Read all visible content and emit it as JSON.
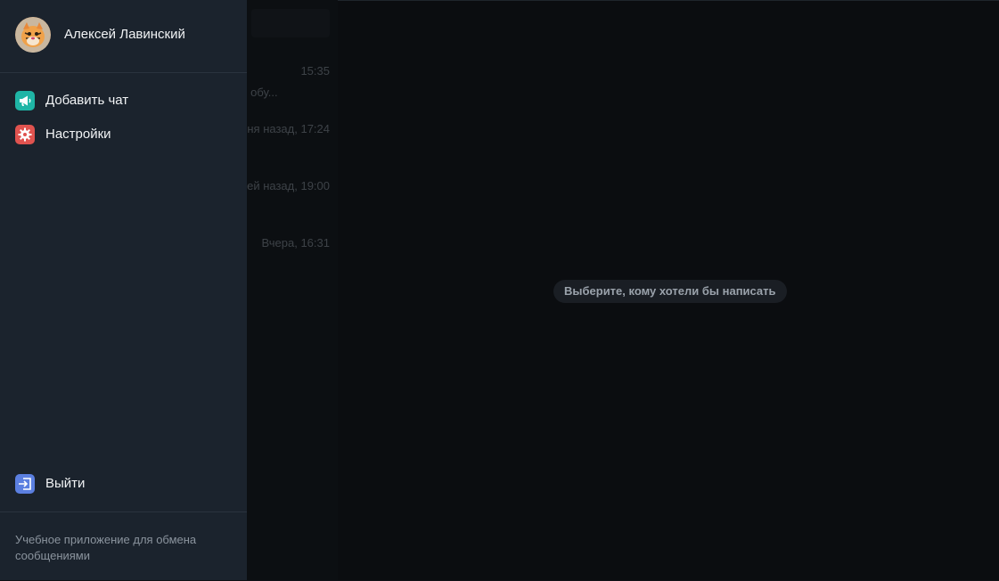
{
  "background_chats": {
    "rows": [
      {
        "time": "15:35",
        "preview": "сто обу..."
      },
      {
        "time": "ня назад, 17:24",
        "preview": ""
      },
      {
        "time": "ей назад, 19:00",
        "preview": ""
      },
      {
        "time": "Вчера, 16:31",
        "preview": ""
      }
    ]
  },
  "main": {
    "placeholder": "Выберите, кому хотели бы написать"
  },
  "drawer": {
    "user_name": "Алексей Лавинский",
    "menu": [
      {
        "label": "Добавить чат",
        "icon": "megaphone-icon",
        "color": "#1fb5a6"
      },
      {
        "label": "Настройки",
        "icon": "gear-icon",
        "color": "#e0534f"
      }
    ],
    "logout": {
      "label": "Выйти",
      "icon": "logout-icon",
      "color": "#5b7fe0"
    },
    "footer": "Учебное приложение для обмена сообщениями"
  },
  "colors": {
    "drawer_bg": "#1b232d",
    "main_bg": "#0b0d10",
    "overlay_bg": "#171c22"
  }
}
